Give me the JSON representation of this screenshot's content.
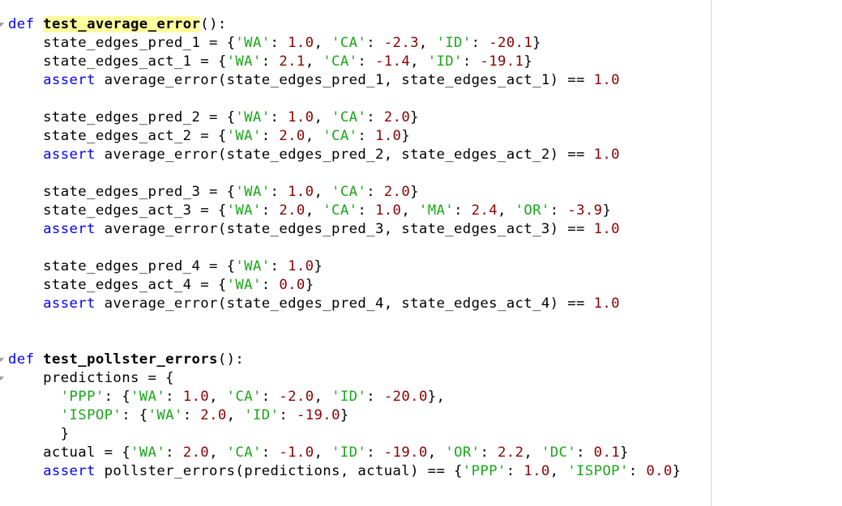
{
  "editor": {
    "language": "python",
    "highlighted_symbol": "test_average_error",
    "lines": [
      {
        "tokens": [
          {
            "t": "kw",
            "v": "def"
          },
          {
            "t": "p",
            "v": " "
          },
          {
            "t": "fnhl",
            "v": "test_average_error"
          },
          {
            "t": "p",
            "v": "():"
          }
        ]
      },
      {
        "tokens": [
          {
            "t": "p",
            "v": "    state_edges_pred_1 = {"
          },
          {
            "t": "str",
            "v": "'WA'"
          },
          {
            "t": "p",
            "v": ": "
          },
          {
            "t": "num",
            "v": "1.0"
          },
          {
            "t": "p",
            "v": ", "
          },
          {
            "t": "str",
            "v": "'CA'"
          },
          {
            "t": "p",
            "v": ": "
          },
          {
            "t": "num",
            "v": "-2.3"
          },
          {
            "t": "p",
            "v": ", "
          },
          {
            "t": "str",
            "v": "'ID'"
          },
          {
            "t": "p",
            "v": ": "
          },
          {
            "t": "num",
            "v": "-20.1"
          },
          {
            "t": "p",
            "v": "}"
          }
        ]
      },
      {
        "tokens": [
          {
            "t": "p",
            "v": "    state_edges_act_1 = {"
          },
          {
            "t": "str",
            "v": "'WA'"
          },
          {
            "t": "p",
            "v": ": "
          },
          {
            "t": "num",
            "v": "2.1"
          },
          {
            "t": "p",
            "v": ", "
          },
          {
            "t": "str",
            "v": "'CA'"
          },
          {
            "t": "p",
            "v": ": "
          },
          {
            "t": "num",
            "v": "-1.4"
          },
          {
            "t": "p",
            "v": ", "
          },
          {
            "t": "str",
            "v": "'ID'"
          },
          {
            "t": "p",
            "v": ": "
          },
          {
            "t": "num",
            "v": "-19.1"
          },
          {
            "t": "p",
            "v": "}"
          }
        ]
      },
      {
        "tokens": [
          {
            "t": "p",
            "v": "    "
          },
          {
            "t": "kw",
            "v": "assert"
          },
          {
            "t": "p",
            "v": " average_error(state_edges_pred_1, state_edges_act_1) == "
          },
          {
            "t": "num",
            "v": "1.0"
          }
        ]
      },
      {
        "tokens": []
      },
      {
        "tokens": [
          {
            "t": "p",
            "v": "    state_edges_pred_2 = {"
          },
          {
            "t": "str",
            "v": "'WA'"
          },
          {
            "t": "p",
            "v": ": "
          },
          {
            "t": "num",
            "v": "1.0"
          },
          {
            "t": "p",
            "v": ", "
          },
          {
            "t": "str",
            "v": "'CA'"
          },
          {
            "t": "p",
            "v": ": "
          },
          {
            "t": "num",
            "v": "2.0"
          },
          {
            "t": "p",
            "v": "}"
          }
        ]
      },
      {
        "tokens": [
          {
            "t": "p",
            "v": "    state_edges_act_2 = {"
          },
          {
            "t": "str",
            "v": "'WA'"
          },
          {
            "t": "p",
            "v": ": "
          },
          {
            "t": "num",
            "v": "2.0"
          },
          {
            "t": "p",
            "v": ", "
          },
          {
            "t": "str",
            "v": "'CA'"
          },
          {
            "t": "p",
            "v": ": "
          },
          {
            "t": "num",
            "v": "1.0"
          },
          {
            "t": "p",
            "v": "}"
          }
        ]
      },
      {
        "tokens": [
          {
            "t": "p",
            "v": "    "
          },
          {
            "t": "kw",
            "v": "assert"
          },
          {
            "t": "p",
            "v": " average_error(state_edges_pred_2, state_edges_act_2) == "
          },
          {
            "t": "num",
            "v": "1.0"
          }
        ]
      },
      {
        "tokens": []
      },
      {
        "tokens": [
          {
            "t": "p",
            "v": "    state_edges_pred_3 = {"
          },
          {
            "t": "str",
            "v": "'WA'"
          },
          {
            "t": "p",
            "v": ": "
          },
          {
            "t": "num",
            "v": "1.0"
          },
          {
            "t": "p",
            "v": ", "
          },
          {
            "t": "str",
            "v": "'CA'"
          },
          {
            "t": "p",
            "v": ": "
          },
          {
            "t": "num",
            "v": "2.0"
          },
          {
            "t": "p",
            "v": "}"
          }
        ]
      },
      {
        "tokens": [
          {
            "t": "p",
            "v": "    state_edges_act_3 = {"
          },
          {
            "t": "str",
            "v": "'WA'"
          },
          {
            "t": "p",
            "v": ": "
          },
          {
            "t": "num",
            "v": "2.0"
          },
          {
            "t": "p",
            "v": ", "
          },
          {
            "t": "str",
            "v": "'CA'"
          },
          {
            "t": "p",
            "v": ": "
          },
          {
            "t": "num",
            "v": "1.0"
          },
          {
            "t": "p",
            "v": ", "
          },
          {
            "t": "str",
            "v": "'MA'"
          },
          {
            "t": "p",
            "v": ": "
          },
          {
            "t": "num",
            "v": "2.4"
          },
          {
            "t": "p",
            "v": ", "
          },
          {
            "t": "str",
            "v": "'OR'"
          },
          {
            "t": "p",
            "v": ": "
          },
          {
            "t": "num",
            "v": "-3.9"
          },
          {
            "t": "p",
            "v": "}"
          }
        ]
      },
      {
        "tokens": [
          {
            "t": "p",
            "v": "    "
          },
          {
            "t": "kw",
            "v": "assert"
          },
          {
            "t": "p",
            "v": " average_error(state_edges_pred_3, state_edges_act_3) == "
          },
          {
            "t": "num",
            "v": "1.0"
          }
        ]
      },
      {
        "tokens": []
      },
      {
        "tokens": [
          {
            "t": "p",
            "v": "    state_edges_pred_4 = {"
          },
          {
            "t": "str",
            "v": "'WA'"
          },
          {
            "t": "p",
            "v": ": "
          },
          {
            "t": "num",
            "v": "1.0"
          },
          {
            "t": "p",
            "v": "}"
          }
        ]
      },
      {
        "tokens": [
          {
            "t": "p",
            "v": "    state_edges_act_4 = {"
          },
          {
            "t": "str",
            "v": "'WA'"
          },
          {
            "t": "p",
            "v": ": "
          },
          {
            "t": "num",
            "v": "0.0"
          },
          {
            "t": "p",
            "v": "}"
          }
        ]
      },
      {
        "tokens": [
          {
            "t": "p",
            "v": "    "
          },
          {
            "t": "kw",
            "v": "assert"
          },
          {
            "t": "p",
            "v": " average_error(state_edges_pred_4, state_edges_act_4) == "
          },
          {
            "t": "num",
            "v": "1.0"
          }
        ]
      },
      {
        "tokens": []
      },
      {
        "tokens": []
      },
      {
        "tokens": [
          {
            "t": "kw",
            "v": "def"
          },
          {
            "t": "p",
            "v": " "
          },
          {
            "t": "fn",
            "v": "test_pollster_errors"
          },
          {
            "t": "p",
            "v": "():"
          }
        ]
      },
      {
        "tokens": [
          {
            "t": "p",
            "v": "    predictions = {"
          }
        ]
      },
      {
        "tokens": [
          {
            "t": "p",
            "v": "      "
          },
          {
            "t": "str",
            "v": "'PPP'"
          },
          {
            "t": "p",
            "v": ": {"
          },
          {
            "t": "str",
            "v": "'WA'"
          },
          {
            "t": "p",
            "v": ": "
          },
          {
            "t": "num",
            "v": "1.0"
          },
          {
            "t": "p",
            "v": ", "
          },
          {
            "t": "str",
            "v": "'CA'"
          },
          {
            "t": "p",
            "v": ": "
          },
          {
            "t": "num",
            "v": "-2.0"
          },
          {
            "t": "p",
            "v": ", "
          },
          {
            "t": "str",
            "v": "'ID'"
          },
          {
            "t": "p",
            "v": ": "
          },
          {
            "t": "num",
            "v": "-20.0"
          },
          {
            "t": "p",
            "v": "},"
          }
        ]
      },
      {
        "tokens": [
          {
            "t": "p",
            "v": "      "
          },
          {
            "t": "str",
            "v": "'ISPOP'"
          },
          {
            "t": "p",
            "v": ": {"
          },
          {
            "t": "str",
            "v": "'WA'"
          },
          {
            "t": "p",
            "v": ": "
          },
          {
            "t": "num",
            "v": "2.0"
          },
          {
            "t": "p",
            "v": ", "
          },
          {
            "t": "str",
            "v": "'ID'"
          },
          {
            "t": "p",
            "v": ": "
          },
          {
            "t": "num",
            "v": "-19.0"
          },
          {
            "t": "p",
            "v": "}"
          }
        ]
      },
      {
        "tokens": [
          {
            "t": "p",
            "v": "      }"
          }
        ]
      },
      {
        "tokens": [
          {
            "t": "p",
            "v": "    actual = {"
          },
          {
            "t": "str",
            "v": "'WA'"
          },
          {
            "t": "p",
            "v": ": "
          },
          {
            "t": "num",
            "v": "2.0"
          },
          {
            "t": "p",
            "v": ", "
          },
          {
            "t": "str",
            "v": "'CA'"
          },
          {
            "t": "p",
            "v": ": "
          },
          {
            "t": "num",
            "v": "-1.0"
          },
          {
            "t": "p",
            "v": ", "
          },
          {
            "t": "str",
            "v": "'ID'"
          },
          {
            "t": "p",
            "v": ": "
          },
          {
            "t": "num",
            "v": "-19.0"
          },
          {
            "t": "p",
            "v": ", "
          },
          {
            "t": "str",
            "v": "'OR'"
          },
          {
            "t": "p",
            "v": ": "
          },
          {
            "t": "num",
            "v": "2.2"
          },
          {
            "t": "p",
            "v": ", "
          },
          {
            "t": "str",
            "v": "'DC'"
          },
          {
            "t": "p",
            "v": ": "
          },
          {
            "t": "num",
            "v": "0.1"
          },
          {
            "t": "p",
            "v": "}"
          }
        ]
      },
      {
        "tokens": [
          {
            "t": "p",
            "v": "    "
          },
          {
            "t": "kw",
            "v": "assert"
          },
          {
            "t": "p",
            "v": " pollster_errors(predictions, actual) == {"
          },
          {
            "t": "str",
            "v": "'PPP'"
          },
          {
            "t": "p",
            "v": ": "
          },
          {
            "t": "num",
            "v": "1.0"
          },
          {
            "t": "p",
            "v": ", "
          },
          {
            "t": "str",
            "v": "'ISPOP'"
          },
          {
            "t": "p",
            "v": ": "
          },
          {
            "t": "num",
            "v": "0.0"
          },
          {
            "t": "p",
            "v": "}"
          }
        ]
      }
    ],
    "fold_markers": [
      {
        "line": 0,
        "icon": "fold-arrow-icon"
      },
      {
        "line": 18,
        "icon": "fold-arrow-icon"
      },
      {
        "line": 19,
        "icon": "fold-arrow-icon"
      }
    ]
  },
  "colors": {
    "keyword": "#0000ff",
    "string": "#1aa81a",
    "number": "#8b0000",
    "text": "#000000",
    "highlight": "#fffc9e"
  }
}
